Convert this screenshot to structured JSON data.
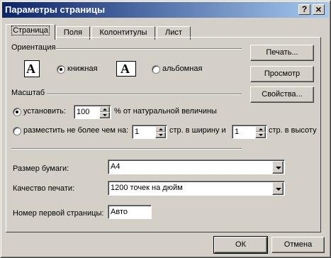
{
  "window": {
    "title": "Параметры страницы",
    "help_label": "?",
    "close_label": "×"
  },
  "tabs": [
    {
      "label": "Страница",
      "active": true
    },
    {
      "label": "Поля"
    },
    {
      "label": "Колонтитулы"
    },
    {
      "label": "Лист"
    }
  ],
  "orientation": {
    "group_label": "Ориентация",
    "portrait_label": "книжная",
    "landscape_label": "альбомная",
    "icon_letter": "A",
    "selected": "portrait"
  },
  "scale": {
    "group_label": "Масштаб",
    "adjust_label": "установить:",
    "adjust_value": "100",
    "adjust_suffix": "% от натуральной величины",
    "fit_label": "разместить не более чем на:",
    "fit_wide_value": "1",
    "fit_wide_suffix": "стр. в ширину и",
    "fit_tall_value": "1",
    "fit_tall_suffix": "стр. в высоту",
    "selected": "adjust"
  },
  "paper": {
    "label": "Размер бумаги:",
    "value": "A4"
  },
  "quality": {
    "label": "Качество печати:",
    "value": "1200 точек на дюйм"
  },
  "first_page": {
    "label": "Номер первой страницы:",
    "value": "Авто"
  },
  "side_buttons": {
    "print": "Печать...",
    "preview": "Просмотр",
    "options": "Свойства..."
  },
  "footer_buttons": {
    "ok": "ОК",
    "cancel": "Отмена"
  }
}
